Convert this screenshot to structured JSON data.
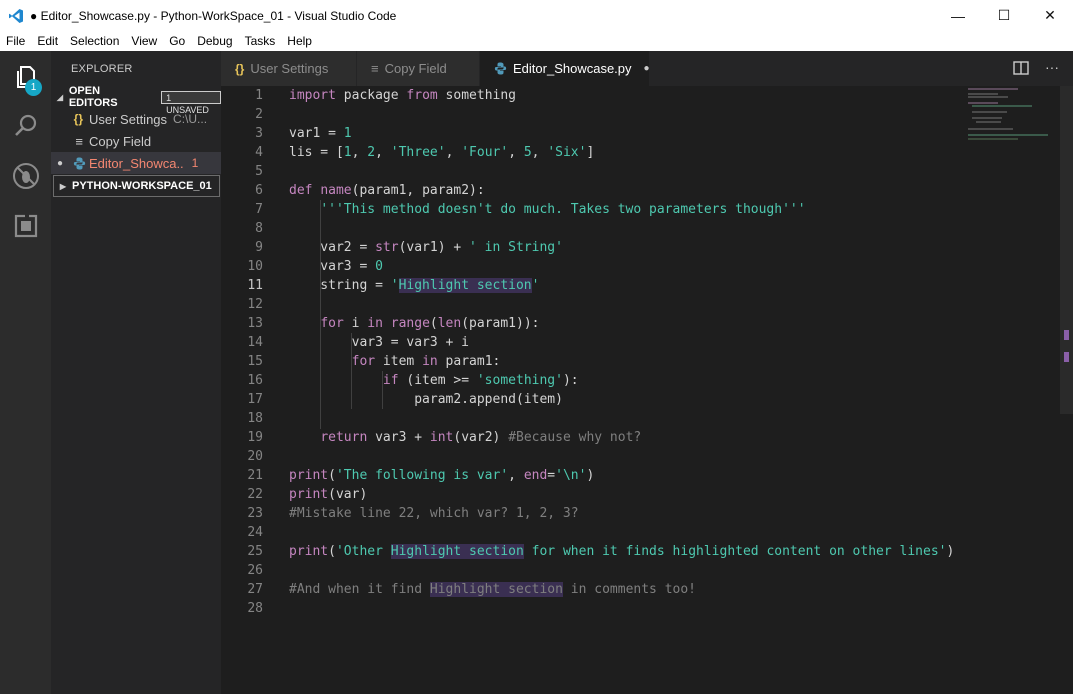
{
  "window": {
    "title": "● Editor_Showcase.py - Python-WorkSpace_01 - Visual Studio Code",
    "controls": {
      "minimize": "—",
      "maximize": "☐",
      "close": "✕"
    }
  },
  "menu": [
    "File",
    "Edit",
    "Selection",
    "View",
    "Go",
    "Debug",
    "Tasks",
    "Help"
  ],
  "activity": {
    "explorer_badge": "1"
  },
  "sidebar": {
    "title": "EXPLORER",
    "open_editors": {
      "label": "OPEN EDITORS",
      "badge": "1 UNSAVED",
      "items": [
        {
          "name": "User Settings",
          "path": "C:\\U...",
          "icon": "{}"
        },
        {
          "name": "Copy Field",
          "path": "",
          "icon": "≡"
        },
        {
          "name": "Editor_Showca..",
          "path": "1",
          "icon": "py"
        }
      ]
    },
    "workspace": {
      "label": "PYTHON-WORKSPACE_01"
    }
  },
  "tabs": [
    {
      "label": "User Settings",
      "icon": "{}"
    },
    {
      "label": "Copy Field",
      "icon": "≡"
    },
    {
      "label": "Editor_Showcase.py",
      "icon": "py"
    }
  ],
  "editor": {
    "current_line": 11,
    "lines": [
      "import package from something",
      "",
      "var1 = 1",
      "lis = [1, 2, 'Three', 'Four', 5, 'Six']",
      "",
      "def name(param1, param2):",
      "    '''This method doesn't do much. Takes two parameters though'''",
      "",
      "    var2 = str(var1) + ' in String'",
      "    var3 = 0",
      "    string = 'Highlight section'",
      "",
      "    for i in range(len(param1)):",
      "        var3 = var3 + i",
      "        for item in param1:",
      "            if (item >= 'something'):",
      "                param2.append(item)",
      "",
      "    return var3 + int(var2) #Because why not?",
      "",
      "print('The following is var', end='\\n')",
      "print(var)",
      "#Mistake line 22, which var? 1, 2, 3?",
      "",
      "print('Other Highlight section for when it finds highlighted content on other lines')",
      "",
      "#And when it find Highlight section in comments too!",
      ""
    ]
  },
  "colors": {
    "keyword": "#c586c0",
    "function": "#dcdcaa",
    "string": "#ce9178",
    "number": "#b5cea8",
    "comment": "#6a9955",
    "builtin": "#4ec9b0",
    "highlight": "#3a2f52"
  }
}
